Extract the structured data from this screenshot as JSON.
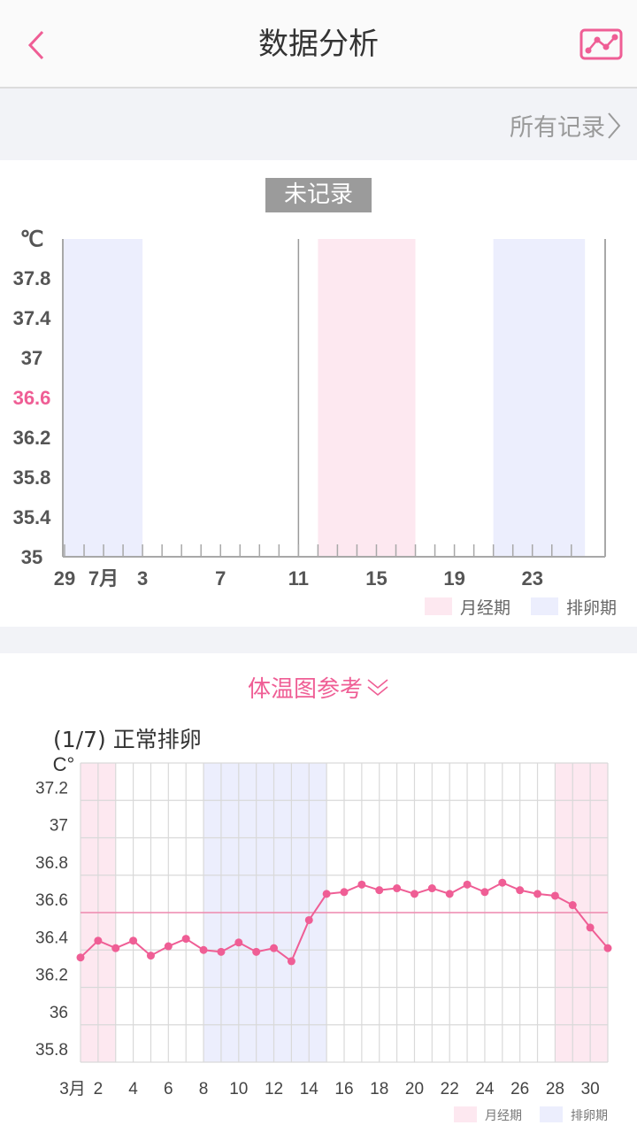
{
  "header": {
    "title": "数据分析",
    "back_icon": "chevron-left-icon",
    "chart_icon": "line-chart-icon"
  },
  "records_link": {
    "label": "所有记录",
    "icon": "chevron-right-icon"
  },
  "colors": {
    "accent": "#ef5e95",
    "period_band": "#fde8f0",
    "ovulation_band": "#eceefd",
    "axis": "#a8a8a8",
    "grid": "#d9d9d9",
    "text_dark": "#555555",
    "badge_bg": "#9b9b9b"
  },
  "chart_data": [
    {
      "type": "line",
      "title": "未记录",
      "ylabel": "℃",
      "ylim": [
        35,
        38.0
      ],
      "yticks": [
        "37.8",
        "37.4",
        "37",
        "36.6",
        "36.2",
        "35.8",
        "35.4",
        "35"
      ],
      "highlight_ytick": "36.6",
      "x_start_index": -2,
      "x_days": 27,
      "xtick_labels": [
        {
          "index": 0,
          "label": "29"
        },
        {
          "index": 2,
          "label": "7月"
        },
        {
          "index": 4,
          "label": "3"
        },
        {
          "index": 8,
          "label": "7"
        },
        {
          "index": 12,
          "label": "11"
        },
        {
          "index": 16,
          "label": "15"
        },
        {
          "index": 20,
          "label": "19"
        },
        {
          "index": 24,
          "label": "23"
        }
      ],
      "today_index": 12,
      "bands": [
        {
          "type": "ovulation",
          "from": -1,
          "to": 4
        },
        {
          "type": "period",
          "from": 13,
          "to": 18
        },
        {
          "type": "ovulation",
          "from": 22,
          "to": 26.7
        }
      ],
      "series": [],
      "legend": [
        {
          "label": "月经期",
          "type": "period"
        },
        {
          "label": "排卵期",
          "type": "ovulation"
        }
      ],
      "legend_position": "bottom-right"
    },
    {
      "type": "line",
      "section_title": "体温图参考",
      "title": "(1/7) 正常排卵",
      "ylabel": "C°",
      "ylim": [
        35.8,
        37.4
      ],
      "yticks": [
        "37.2",
        "37",
        "36.8",
        "36.6",
        "36.4",
        "36.2",
        "36",
        "35.8"
      ],
      "reference_line": 36.6,
      "x": [
        1,
        2,
        3,
        4,
        5,
        6,
        7,
        8,
        9,
        10,
        11,
        12,
        13,
        14,
        15,
        16,
        17,
        18,
        19,
        20,
        21,
        22,
        23,
        24,
        25,
        26,
        27,
        28,
        29,
        30,
        31
      ],
      "xtick_labels": [
        {
          "day": 1,
          "label": "3月"
        },
        {
          "day": 2,
          "label": "2"
        },
        {
          "day": 4,
          "label": "4"
        },
        {
          "day": 6,
          "label": "6"
        },
        {
          "day": 8,
          "label": "8"
        },
        {
          "day": 10,
          "label": "10"
        },
        {
          "day": 12,
          "label": "12"
        },
        {
          "day": 14,
          "label": "14"
        },
        {
          "day": 16,
          "label": "16"
        },
        {
          "day": 18,
          "label": "18"
        },
        {
          "day": 20,
          "label": "20"
        },
        {
          "day": 22,
          "label": "22"
        },
        {
          "day": 24,
          "label": "24"
        },
        {
          "day": 26,
          "label": "26"
        },
        {
          "day": 28,
          "label": "28"
        },
        {
          "day": 30,
          "label": "30"
        }
      ],
      "bands": [
        {
          "type": "period",
          "from": 1,
          "to": 3
        },
        {
          "type": "ovulation",
          "from": 8,
          "to": 15
        },
        {
          "type": "period",
          "from": 28,
          "to": 31
        }
      ],
      "series": [
        {
          "name": "体温",
          "values": [
            36.36,
            36.45,
            36.41,
            36.45,
            36.37,
            36.42,
            36.46,
            36.4,
            36.39,
            36.44,
            36.39,
            36.41,
            36.34,
            36.56,
            36.7,
            36.71,
            36.75,
            36.72,
            36.73,
            36.7,
            36.73,
            36.7,
            36.75,
            36.71,
            36.76,
            36.72,
            36.7,
            36.69,
            36.64,
            36.52,
            36.41
          ]
        }
      ],
      "legend": [
        {
          "label": "月经期",
          "type": "period"
        },
        {
          "label": "排卵期",
          "type": "ovulation"
        }
      ],
      "legend_position": "bottom-right"
    }
  ]
}
